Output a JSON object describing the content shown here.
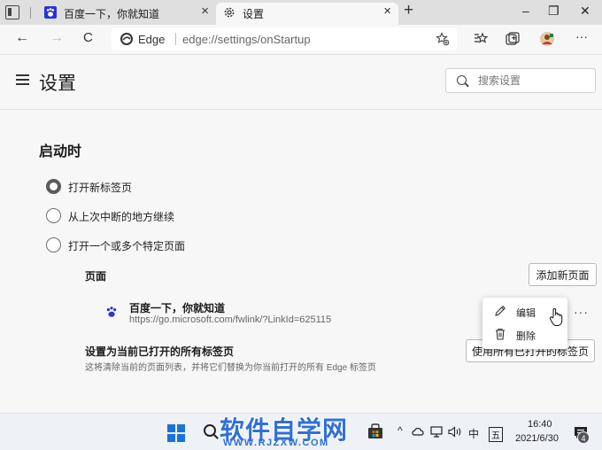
{
  "tabs": [
    {
      "title": "百度一下，你就知道",
      "close": "×"
    },
    {
      "title": "设置",
      "close": "×"
    }
  ],
  "tabstrip": {
    "new_tab": "+",
    "minimize": "–",
    "restore": "❐",
    "close": "✕"
  },
  "toolbar": {
    "back": "←",
    "forward": "→",
    "refresh": "C",
    "scheme_label": "Edge",
    "url": "edge://settings/onStartup",
    "more": "···"
  },
  "settings": {
    "title": "设置",
    "search_placeholder": "搜索设置"
  },
  "startup": {
    "title": "启动时",
    "options": [
      {
        "label": "打开新标签页",
        "checked": true
      },
      {
        "label": "从上次中断的地方继续",
        "checked": false
      },
      {
        "label": "打开一个或多个特定页面",
        "checked": false
      }
    ],
    "pages_label": "页面",
    "add_page_button": "添加新页面",
    "page": {
      "name": "百度一下，你就知道",
      "url": "https://go.microsoft.com/fwlink/?LinkId=625115",
      "more": "···"
    },
    "set_current": {
      "title": "设置为当前已打开的所有标签页",
      "description": "这将清除当前的页面列表，并将它们替换为你当前打开的所有 Edge 标签页",
      "button": "使用所有已打开的标签页"
    }
  },
  "context_menu": {
    "items": [
      {
        "label": "编辑",
        "icon": "pencil-icon"
      },
      {
        "label": "删除",
        "icon": "trash-icon"
      }
    ]
  },
  "taskbar": {
    "watermark_main": "软件自学网",
    "watermark_sub": "WWW.RJZXW.COM",
    "tray_chevron": "^",
    "ime": "中",
    "ime_mode": "五",
    "time": "16:40",
    "date": "2021/6/30",
    "notifications": "4"
  },
  "colors": {
    "accent": "#1a73d9",
    "baidu_blue": "#2932e1",
    "watermark": "#2f6fd8"
  }
}
